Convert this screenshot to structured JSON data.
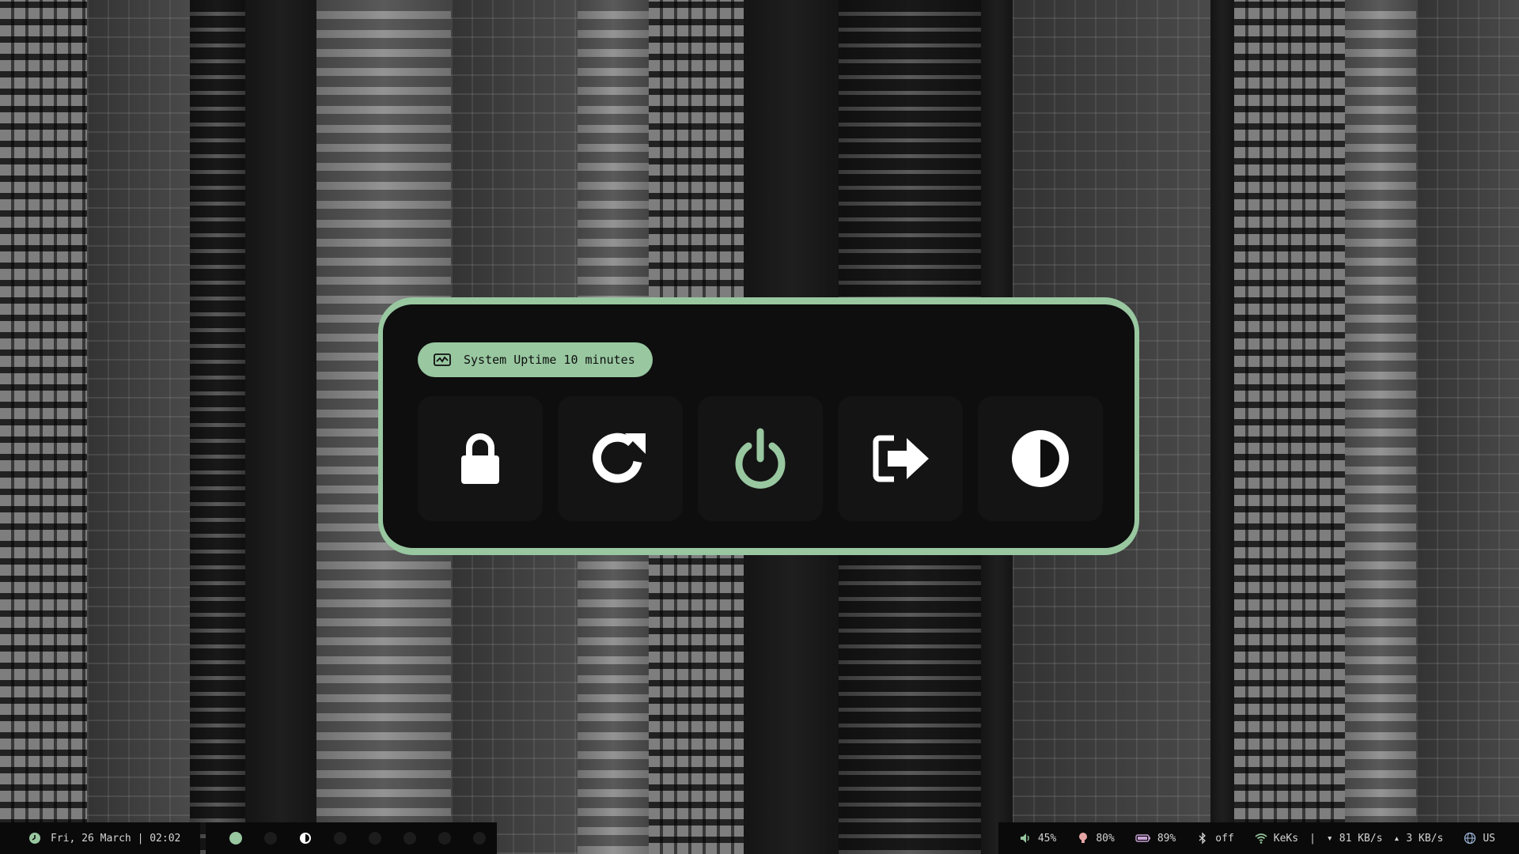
{
  "theme": {
    "accent": "#98c7a0",
    "panel_bg": "#0e0e0e",
    "button_bg": "#141414",
    "bar_bg": "#0a0a0a"
  },
  "power_menu": {
    "uptime_icon": "activity-chart-icon",
    "uptime_label": "System Uptime 10 minutes",
    "buttons": [
      {
        "name": "lock",
        "icon": "lock-icon"
      },
      {
        "name": "reboot",
        "icon": "refresh-icon"
      },
      {
        "name": "shutdown",
        "icon": "power-icon",
        "highlighted": true
      },
      {
        "name": "logout",
        "icon": "logout-arrow-icon"
      },
      {
        "name": "theme",
        "icon": "contrast-icon"
      }
    ]
  },
  "statusbar": {
    "clock": {
      "icon": "clock-icon",
      "text": "Fri, 26 March | 02:02"
    },
    "workspaces": [
      {
        "icon": "dot",
        "active": true
      },
      {
        "icon": "dot",
        "active": false
      },
      {
        "icon": "contrast-icon",
        "active": false
      },
      {
        "icon": "dot",
        "active": false
      },
      {
        "icon": "dot",
        "active": false
      },
      {
        "icon": "dot",
        "active": false
      },
      {
        "icon": "dot",
        "active": false
      },
      {
        "icon": "dot",
        "active": false
      }
    ],
    "volume": {
      "icon": "speaker-icon",
      "text": "45%"
    },
    "brightness": {
      "icon": "bulb-icon",
      "text": "80%"
    },
    "battery": {
      "icon": "battery-icon",
      "text": "89%"
    },
    "bluetooth": {
      "icon": "bluetooth-icon",
      "text": "off"
    },
    "network": {
      "icon": "wifi-icon",
      "ssid": "KeKs",
      "down": "81 KB/s",
      "up": "3 KB/s"
    },
    "keyboard": {
      "icon": "globe-icon",
      "text": "US"
    }
  }
}
